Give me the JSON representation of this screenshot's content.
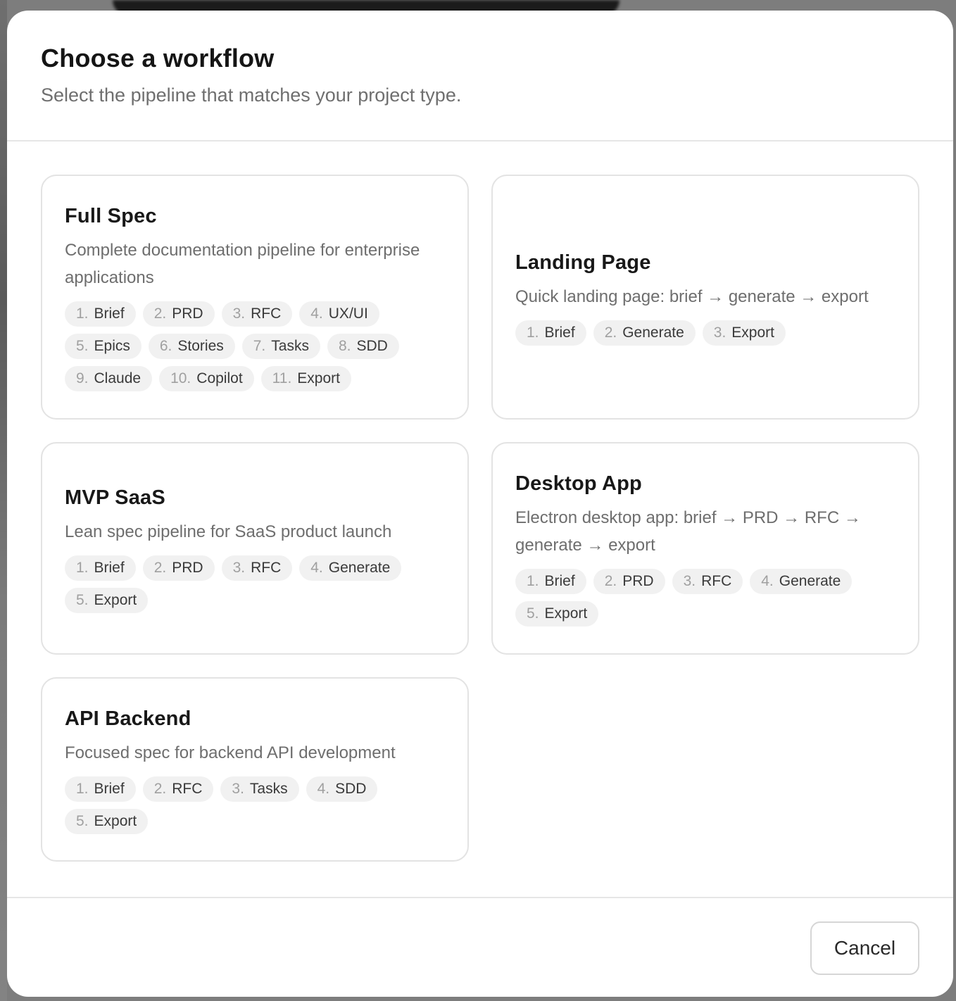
{
  "dialog": {
    "title": "Choose a workflow",
    "subtitle": "Select the pipeline that matches your project type."
  },
  "workflows": [
    {
      "title": "Full Spec",
      "description": "Complete documentation pipeline for enterprise applications",
      "steps": [
        {
          "num": "1.",
          "label": "Brief"
        },
        {
          "num": "2.",
          "label": "PRD"
        },
        {
          "num": "3.",
          "label": "RFC"
        },
        {
          "num": "4.",
          "label": "UX/UI"
        },
        {
          "num": "5.",
          "label": "Epics"
        },
        {
          "num": "6.",
          "label": "Stories"
        },
        {
          "num": "7.",
          "label": "Tasks"
        },
        {
          "num": "8.",
          "label": "SDD"
        },
        {
          "num": "9.",
          "label": "Claude"
        },
        {
          "num": "10.",
          "label": "Copilot"
        },
        {
          "num": "11.",
          "label": "Export"
        }
      ]
    },
    {
      "title": "Landing Page",
      "description": "Quick landing page: brief → generate → export",
      "steps": [
        {
          "num": "1.",
          "label": "Brief"
        },
        {
          "num": "2.",
          "label": "Generate"
        },
        {
          "num": "3.",
          "label": "Export"
        }
      ]
    },
    {
      "title": "MVP SaaS",
      "description": "Lean spec pipeline for SaaS product launch",
      "steps": [
        {
          "num": "1.",
          "label": "Brief"
        },
        {
          "num": "2.",
          "label": "PRD"
        },
        {
          "num": "3.",
          "label": "RFC"
        },
        {
          "num": "4.",
          "label": "Generate"
        },
        {
          "num": "5.",
          "label": "Export"
        }
      ]
    },
    {
      "title": "Desktop App",
      "description": "Electron desktop app: brief → PRD → RFC → generate → export",
      "steps": [
        {
          "num": "1.",
          "label": "Brief"
        },
        {
          "num": "2.",
          "label": "PRD"
        },
        {
          "num": "3.",
          "label": "RFC"
        },
        {
          "num": "4.",
          "label": "Generate"
        },
        {
          "num": "5.",
          "label": "Export"
        }
      ]
    },
    {
      "title": "API Backend",
      "description": "Focused spec for backend API development",
      "steps": [
        {
          "num": "1.",
          "label": "Brief"
        },
        {
          "num": "2.",
          "label": "RFC"
        },
        {
          "num": "3.",
          "label": "Tasks"
        },
        {
          "num": "4.",
          "label": "SDD"
        },
        {
          "num": "5.",
          "label": "Export"
        }
      ]
    }
  ],
  "footer": {
    "cancel_label": "Cancel"
  }
}
